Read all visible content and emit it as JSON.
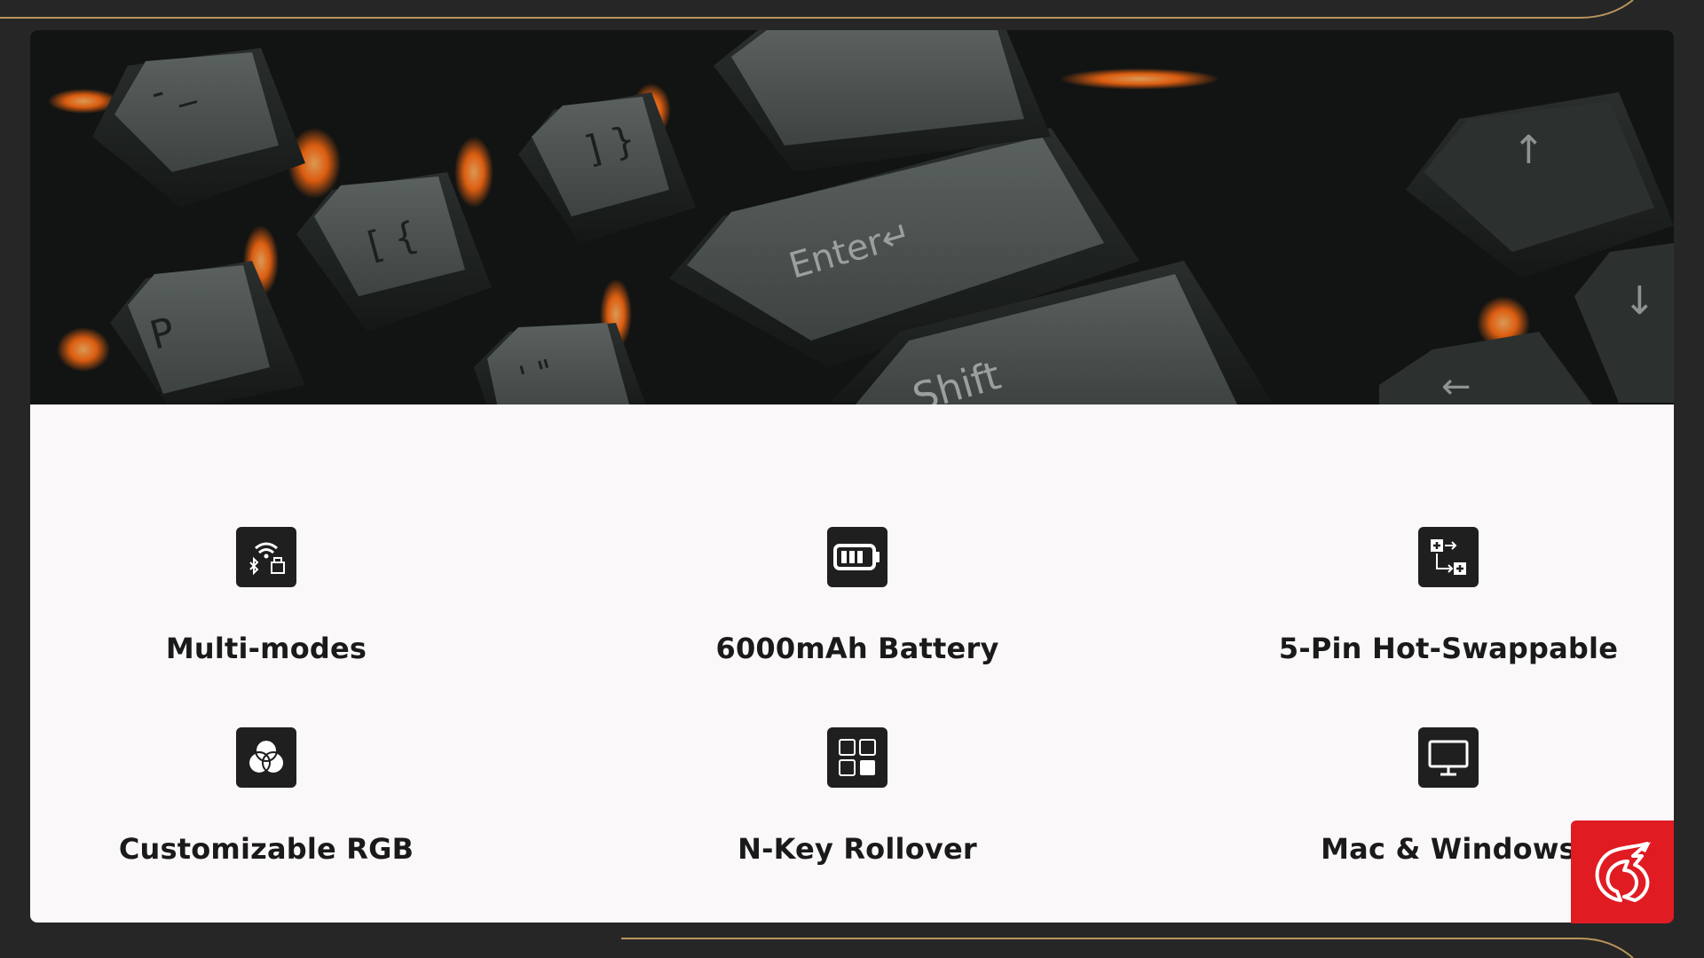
{
  "hero": {
    "image": "mechanical-keyboard-closeup",
    "keycap_legends": {
      "enter": "Enter",
      "shift": "Shift",
      "p": "P",
      "bracket": "[{",
      "brace": "]}",
      "minus": "-_",
      "quote": "' \""
    }
  },
  "features": [
    {
      "label": "Multi-modes",
      "icon": "wireless-bluetooth-icon"
    },
    {
      "label": "6000mAh Battery",
      "icon": "battery-icon"
    },
    {
      "label": "5-Pin Hot-Swappable",
      "icon": "hot-swap-icon"
    },
    {
      "label": "Customizable RGB",
      "icon": "rgb-circles-icon"
    },
    {
      "label": "N-Key Rollover",
      "icon": "grid-keys-icon"
    },
    {
      "label": "Mac & Windows",
      "icon": "monitor-icon"
    }
  ],
  "brand": {
    "logo": "dragon-logo-icon",
    "color": "#e01b22"
  },
  "colors": {
    "background": "#262626",
    "card": "#faf8f9",
    "icon_box": "#1f1f1f",
    "accent_frame": "#b8955a",
    "backlight": "#ff7a1a"
  }
}
